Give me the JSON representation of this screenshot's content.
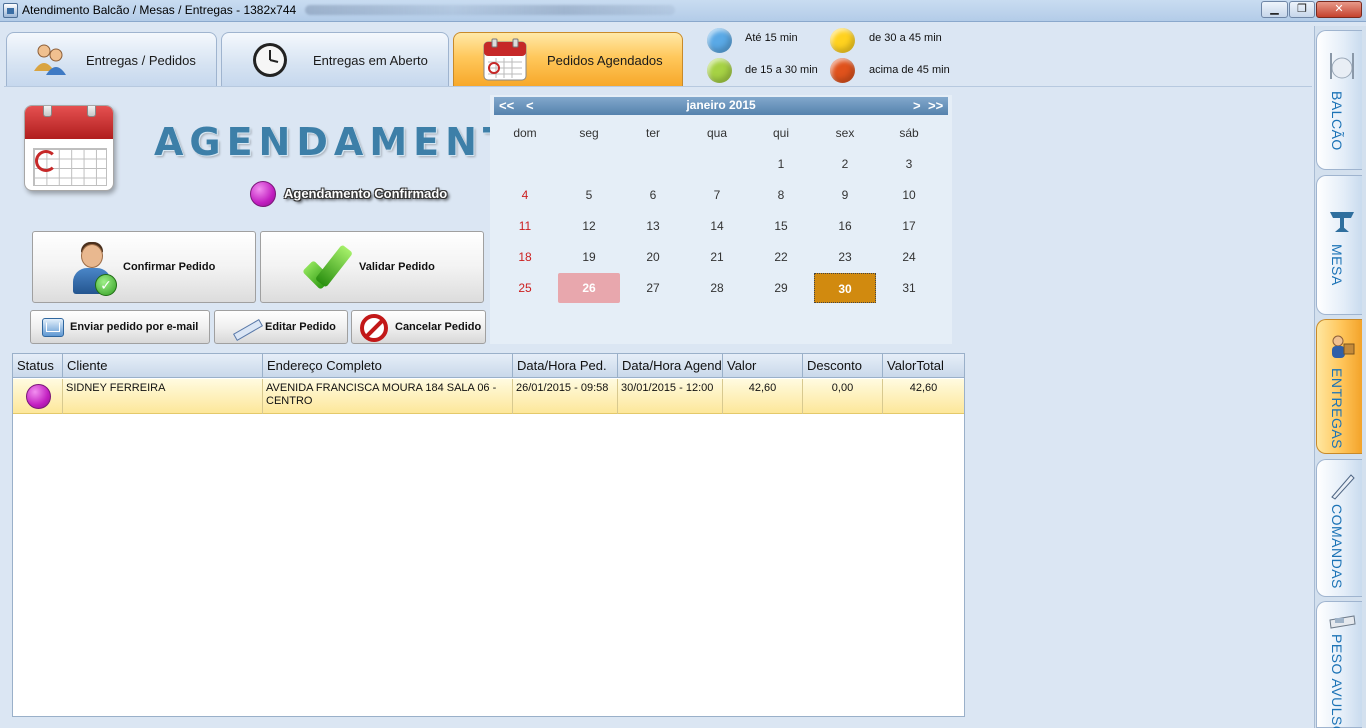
{
  "window": {
    "title": "Atendimento Balcão / Mesas / Entregas - 1382x744",
    "controls": {
      "minimize": "▁",
      "maximize": "❐",
      "close": "✕"
    }
  },
  "tabs": [
    {
      "label": "Entregas / Pedidos",
      "icon": "people-icon",
      "active": false
    },
    {
      "label": "Entregas em Aberto",
      "icon": "clock-icon",
      "active": false
    },
    {
      "label": "Pedidos Agendados",
      "icon": "calendar-icon",
      "active": true
    }
  ],
  "legend": [
    {
      "label": "Até 15 min",
      "color": "#5aa9e6"
    },
    {
      "label": "de 15 a 30 min",
      "color": "#a6d244"
    },
    {
      "label": "de 30 a 45 min",
      "color": "#ffd21f"
    },
    {
      "label": "acima de 45 min",
      "color": "#e0521c"
    }
  ],
  "header": {
    "title": "AGENDAMENTOS",
    "status_label": "Agendamento Confirmado",
    "status_color": "#c21fc1"
  },
  "actions": {
    "confirm": "Confirmar Pedido",
    "validate": "Validar Pedido",
    "email": "Enviar pedido por e-mail",
    "edit": "Editar Pedido",
    "cancel": "Cancelar Pedido"
  },
  "calendar": {
    "month": "janeiro 2015",
    "prev_year": "<<",
    "prev_month": "<",
    "next_month": ">",
    "next_year": ">>",
    "weekdays": [
      "dom",
      "seg",
      "ter",
      "qua",
      "qui",
      "sex",
      "sáb"
    ],
    "weeks": [
      [
        "",
        "",
        "",
        "",
        "1",
        "2",
        "3"
      ],
      [
        "4",
        "5",
        "6",
        "7",
        "8",
        "9",
        "10"
      ],
      [
        "11",
        "12",
        "13",
        "14",
        "15",
        "16",
        "17"
      ],
      [
        "18",
        "19",
        "20",
        "21",
        "22",
        "23",
        "24"
      ],
      [
        "25",
        "26",
        "27",
        "28",
        "29",
        "30",
        "31"
      ]
    ],
    "today": "26",
    "selected": "30"
  },
  "table": {
    "columns": [
      "Status",
      "Cliente",
      "Endereço Completo",
      "Data/Hora Ped.",
      "Data/Hora Agend",
      "Valor",
      "Desconto",
      "ValorTotal"
    ],
    "rows": [
      {
        "status": "confirmado",
        "cliente": "SIDNEY FERREIRA",
        "endereco": "AVENIDA FRANCISCA MOURA 184 SALA 06 - CENTRO",
        "data_pedido": "26/01/2015 - 09:58",
        "data_agendamento": "30/01/2015 - 12:00",
        "valor": "42,60",
        "desconto": "0,00",
        "valor_total": "42,60"
      }
    ]
  },
  "side_tabs": [
    {
      "label": "BALCÃO",
      "icon": "cutlery-icon",
      "active": false
    },
    {
      "label": "MESA",
      "icon": "table-icon",
      "active": false
    },
    {
      "label": "ENTREGAS",
      "icon": "delivery-icon",
      "active": true
    },
    {
      "label": "COMANDAS",
      "icon": "pen-icon",
      "active": false
    },
    {
      "label": "PESO AVULSO",
      "icon": "scale-icon",
      "active": false
    }
  ]
}
